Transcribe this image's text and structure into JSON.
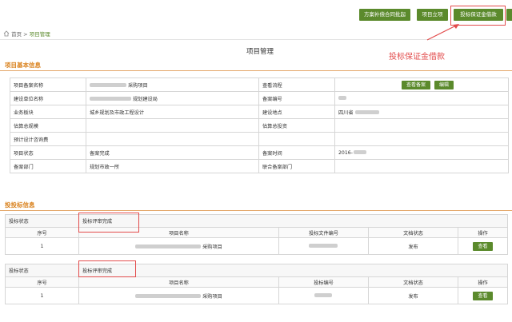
{
  "toolbar": {
    "btn_contract": "方案补偿合同批起",
    "btn_project": "项目立项",
    "btn_deposit": "投标保证金借款"
  },
  "breadcrumb": {
    "home": "首页",
    "sep": ">",
    "current": "项目管理"
  },
  "page_title": "项目管理",
  "annotation": "投标保证金借款",
  "basic": {
    "title": "项目基本信息",
    "rows": [
      {
        "l1": "项目备案名称",
        "v1": "采购项目",
        "l2": "查看流程",
        "v2": ""
      },
      {
        "l1": "建设单位名称",
        "v1": "规划建设局",
        "l2": "备案编号",
        "v2": ""
      },
      {
        "l1": "业务板块",
        "v1": "城乡规划及市政工程设计",
        "l2": "建设地点",
        "v2": "四川省"
      },
      {
        "l1": "估算总规模",
        "v1": "",
        "l2": "估算总投资",
        "v2": ""
      },
      {
        "l1": "预计设计咨询费",
        "v1": "",
        "l2": "",
        "v2": ""
      },
      {
        "l1": "项目状态",
        "v1": "备案完成",
        "l2": "备案时间",
        "v2": "2016-"
      },
      {
        "l1": "备案部门",
        "v1": "规划市政一所",
        "l2": "联合备案部门",
        "v2": ""
      }
    ],
    "btn_view_record": "查看备案",
    "btn_edit": "编辑"
  },
  "bid": {
    "title": "投投标信息",
    "blocks": [
      {
        "status_label": "投标状态",
        "status_value": "投标评审完成",
        "headers": [
          "序号",
          "项目名称",
          "投标文件编号",
          "文档状态",
          "操作"
        ],
        "row": {
          "no": "1",
          "name": "采购项目",
          "doc_no": "",
          "doc_status": "发布",
          "action": "查看"
        }
      },
      {
        "status_label": "投标状态",
        "status_value": "投标评审完成",
        "headers": [
          "序号",
          "项目名称",
          "投标编号",
          "文档状态",
          "操作"
        ],
        "row": {
          "no": "1",
          "name": "采购项目",
          "doc_no": "",
          "doc_status": "发布",
          "action": "查看"
        }
      }
    ]
  },
  "colors": {
    "accent": "#5b8a2c",
    "section": "#d9811d",
    "annotation": "#e24b4b"
  }
}
